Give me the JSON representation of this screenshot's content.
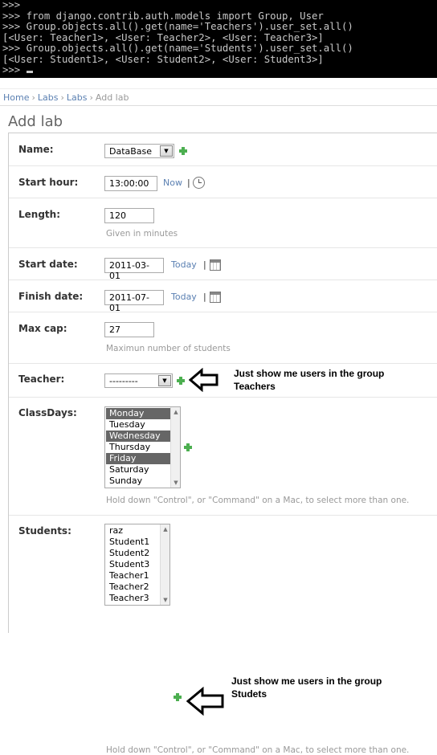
{
  "console": {
    "lines": [
      ">>>",
      ">>> from django.contrib.auth.models import Group, User",
      ">>> Group.objects.all().get(name='Teachers').user_set.all()",
      "[<User: Teacher1>, <User: Teacher2>, <User: Teacher3>]",
      ">>> Group.objects.all().get(name='Students').user_set.all()",
      "[<User: Student1>, <User: Student2>, <User: Student3>]",
      ">>> "
    ]
  },
  "breadcrumbs": {
    "home": "Home",
    "app": "Labs",
    "model": "Labs",
    "current": "Add lab",
    "separator": "›"
  },
  "page_title": "Add lab",
  "form": {
    "name": {
      "label": "Name:",
      "value": "DataBase"
    },
    "start_hour": {
      "label": "Start hour:",
      "value": "13:00:00",
      "now": "Now",
      "sep": "|"
    },
    "length": {
      "label": "Length:",
      "value": "120",
      "help": "Given in minutes"
    },
    "start_date": {
      "label": "Start date:",
      "value": "2011-03-01",
      "today": "Today",
      "sep": "|"
    },
    "finish_date": {
      "label": "Finish date:",
      "value": "2011-07-01",
      "today": "Today",
      "sep": "|"
    },
    "max_cap": {
      "label": "Max cap:",
      "value": "27",
      "help": "Maximun number of students"
    },
    "teacher": {
      "label": "Teacher:",
      "value": "---------"
    },
    "class_days": {
      "label": "ClassDays:",
      "options": [
        "Monday",
        "Tuesday",
        "Wednesday",
        "Thursday",
        "Friday",
        "Saturday",
        "Sunday"
      ],
      "selected": [
        0,
        2,
        4
      ],
      "help": "Hold down \"Control\", or \"Command\" on a Mac, to select more than one."
    },
    "students": {
      "label": "Students:",
      "options": [
        "raz",
        "Student1",
        "Student2",
        "Student3",
        "Teacher1",
        "Teacher2",
        "Teacher3"
      ],
      "help": "Hold down \"Control\", or \"Command\" on a Mac, to select more than one."
    }
  },
  "annotations": {
    "teacher_note_line1": "Just show me users in the group",
    "teacher_note_line2": "Teachers",
    "students_note_line1": "Just show me users in the group",
    "students_note_line2": "Studets"
  },
  "icons": {
    "add": "plus-icon",
    "clock": "clock-icon",
    "calendar": "calendar-icon",
    "arrow": "left-arrow-icon"
  },
  "colors": {
    "link": "#5b80b2",
    "add_icon": "#4caf50",
    "console_bg": "#000000",
    "selected_option": "#666666"
  }
}
